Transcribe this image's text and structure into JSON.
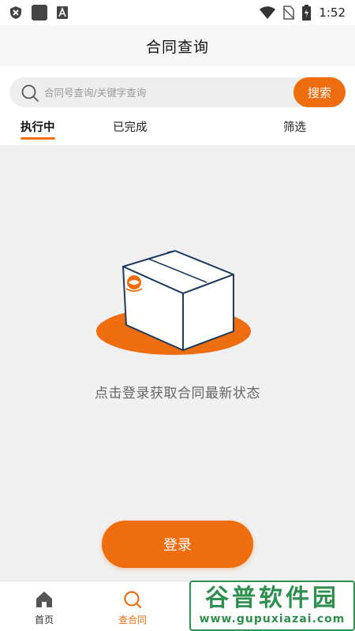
{
  "status_bar": {
    "time": "1:52",
    "icons": [
      "shield-icon",
      "app-square-icon",
      "font-a-icon",
      "wifi-icon",
      "no-sim-icon",
      "battery-charging-icon"
    ]
  },
  "app_bar": {
    "title": "合同查询"
  },
  "search": {
    "placeholder": "合同号查询/关键字查询",
    "value": "",
    "button_label": "搜索"
  },
  "tabs": [
    {
      "label": "执行中",
      "active": true
    },
    {
      "label": "已完成",
      "active": false
    },
    {
      "label": "筛选",
      "active": false
    }
  ],
  "empty_state": {
    "message": "点击登录获取合同最新状态"
  },
  "login_button": {
    "label": "登录"
  },
  "bottom_nav": {
    "items": [
      {
        "label": "首页",
        "icon": "home-icon",
        "active": false
      },
      {
        "label": "查合同",
        "icon": "search-icon",
        "active": true
      }
    ]
  },
  "watermark": {
    "title": "谷普软件园",
    "url": "www.gupuxiazai.com"
  },
  "colors": {
    "accent": "#ee6e0f",
    "background": "#f0f0f0",
    "watermark": "#2f8f4e"
  }
}
